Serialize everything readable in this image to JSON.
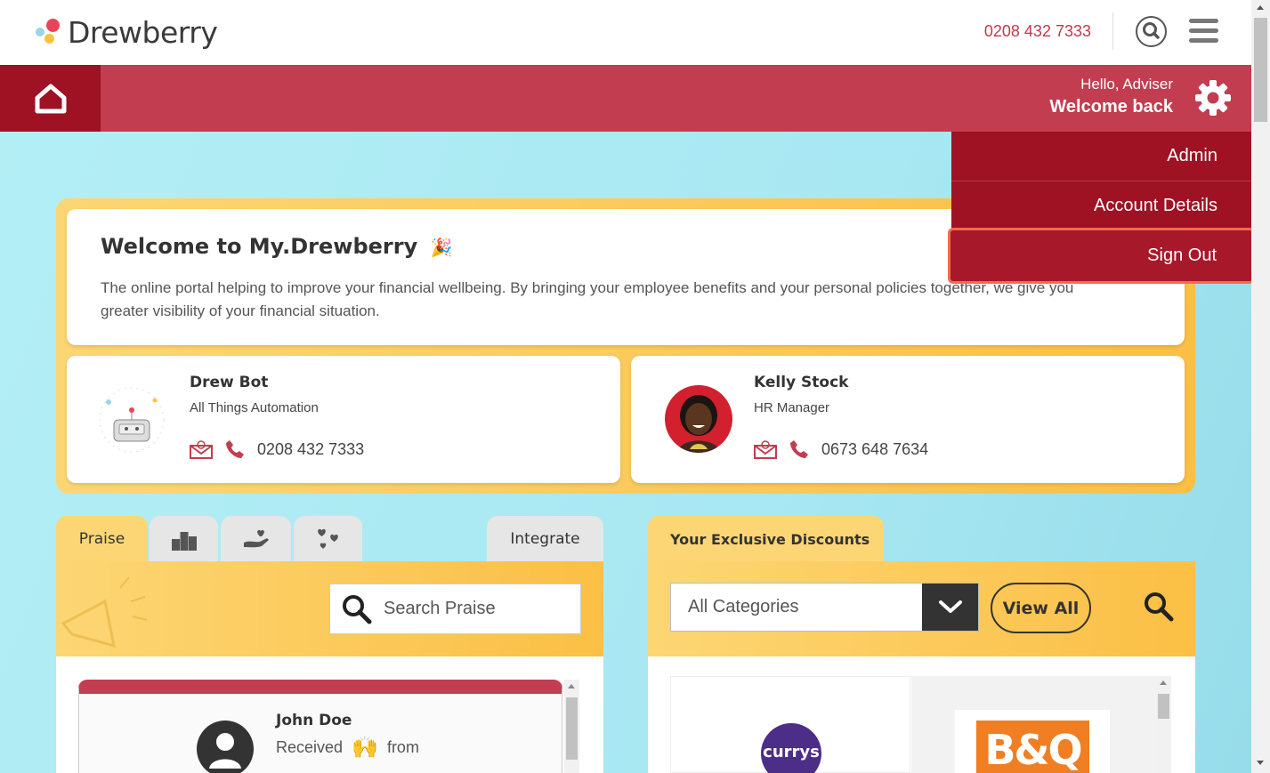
{
  "brand": {
    "name": "Drewberry"
  },
  "header": {
    "phone": "0208 432 7333"
  },
  "greeting": {
    "hello": "Hello, Adviser",
    "welcome": "Welcome back"
  },
  "menu": {
    "items": [
      "Admin",
      "Account Details",
      "Sign Out"
    ]
  },
  "welcome": {
    "title": "Welcome to My.Drewberry",
    "description": "The online portal helping to improve your financial wellbeing. By bringing your employee benefits and your personal policies together, we give you greater visibility of your financial situation."
  },
  "contacts": [
    {
      "name": "Drew Bot",
      "role": "All Things Automation",
      "phone": "0208 432 7333"
    },
    {
      "name": "Kelly Stock",
      "role": "HR Manager",
      "phone": "0673 648 7634"
    }
  ],
  "praise": {
    "tabs": {
      "praise": "Praise",
      "integrate": "Integrate"
    },
    "search_placeholder": "Search Praise",
    "card": {
      "name": "John Doe",
      "received": "Received",
      "from": "from"
    }
  },
  "discounts": {
    "tab": "Your Exclusive Discounts",
    "category": "All Categories",
    "view_all": "View All",
    "brands": [
      "currys",
      "B&Q"
    ]
  },
  "colors": {
    "brand_red": "#c23d4f",
    "dark_red": "#9e1224",
    "yellow": "#fcd674",
    "cyan_bg": "#b3eef5"
  }
}
